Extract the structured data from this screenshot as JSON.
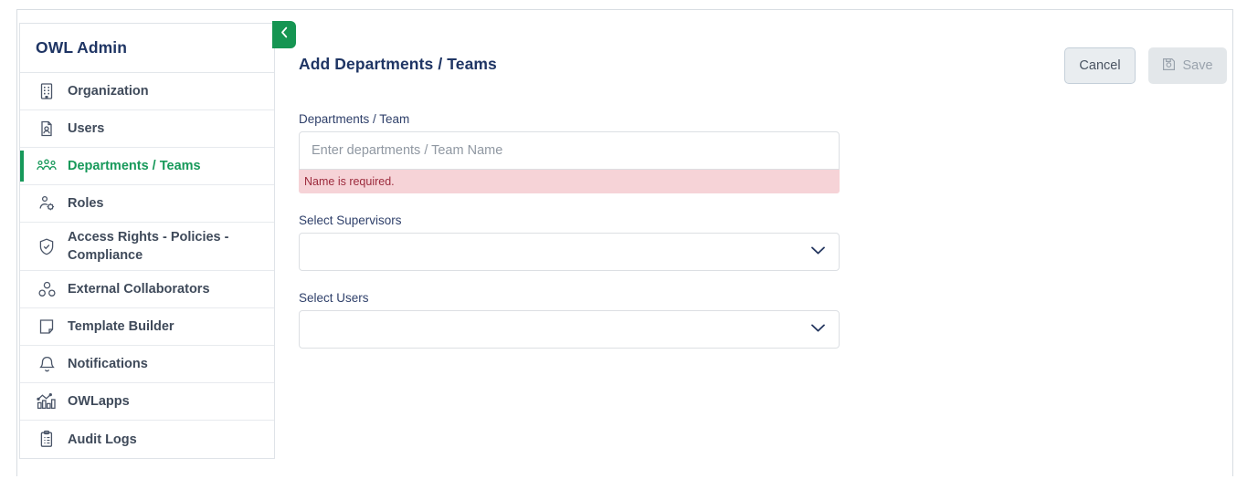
{
  "app": {
    "sidebar_title": "OWL Admin"
  },
  "sidebar": {
    "collapse_toggle_label": "Collapse sidebar",
    "items": [
      {
        "label": "Organization",
        "icon": "building-icon",
        "active": false
      },
      {
        "label": "Users",
        "icon": "user-card-icon",
        "active": false
      },
      {
        "label": "Departments / Teams",
        "icon": "people-group-icon",
        "active": true
      },
      {
        "label": "Roles",
        "icon": "user-gear-icon",
        "active": false
      },
      {
        "label": "Access Rights - Policies - Compliance",
        "icon": "shield-check-icon",
        "active": false
      },
      {
        "label": "External Collaborators",
        "icon": "collaborators-icon",
        "active": false
      },
      {
        "label": "Template Builder",
        "icon": "page-fold-icon",
        "active": false
      },
      {
        "label": "Notifications",
        "icon": "bell-icon",
        "active": false
      },
      {
        "label": "OWLapps",
        "icon": "bar-chart-icon",
        "active": false
      },
      {
        "label": "Audit Logs",
        "icon": "clipboard-list-icon",
        "active": false
      }
    ]
  },
  "main": {
    "heading": "Add Departments / Teams",
    "actions": {
      "cancel_label": "Cancel",
      "save_label": "Save",
      "save_icon": "floppy-disk-icon",
      "save_disabled": true
    },
    "form": {
      "name_field": {
        "label": "Departments / Team",
        "placeholder": "Enter departments / Team Name",
        "value": "",
        "error": "Name is required."
      },
      "supervisors_field": {
        "label": "Select Supervisors",
        "value": "",
        "chevron_icon": "chevron-down-icon"
      },
      "users_field": {
        "label": "Select Users",
        "value": "",
        "chevron_icon": "chevron-down-icon"
      }
    }
  },
  "colors": {
    "accent_green": "#17995a",
    "navy": "#1f3564",
    "error_bg": "#f6d3d7",
    "error_text": "#9c2a3c"
  }
}
